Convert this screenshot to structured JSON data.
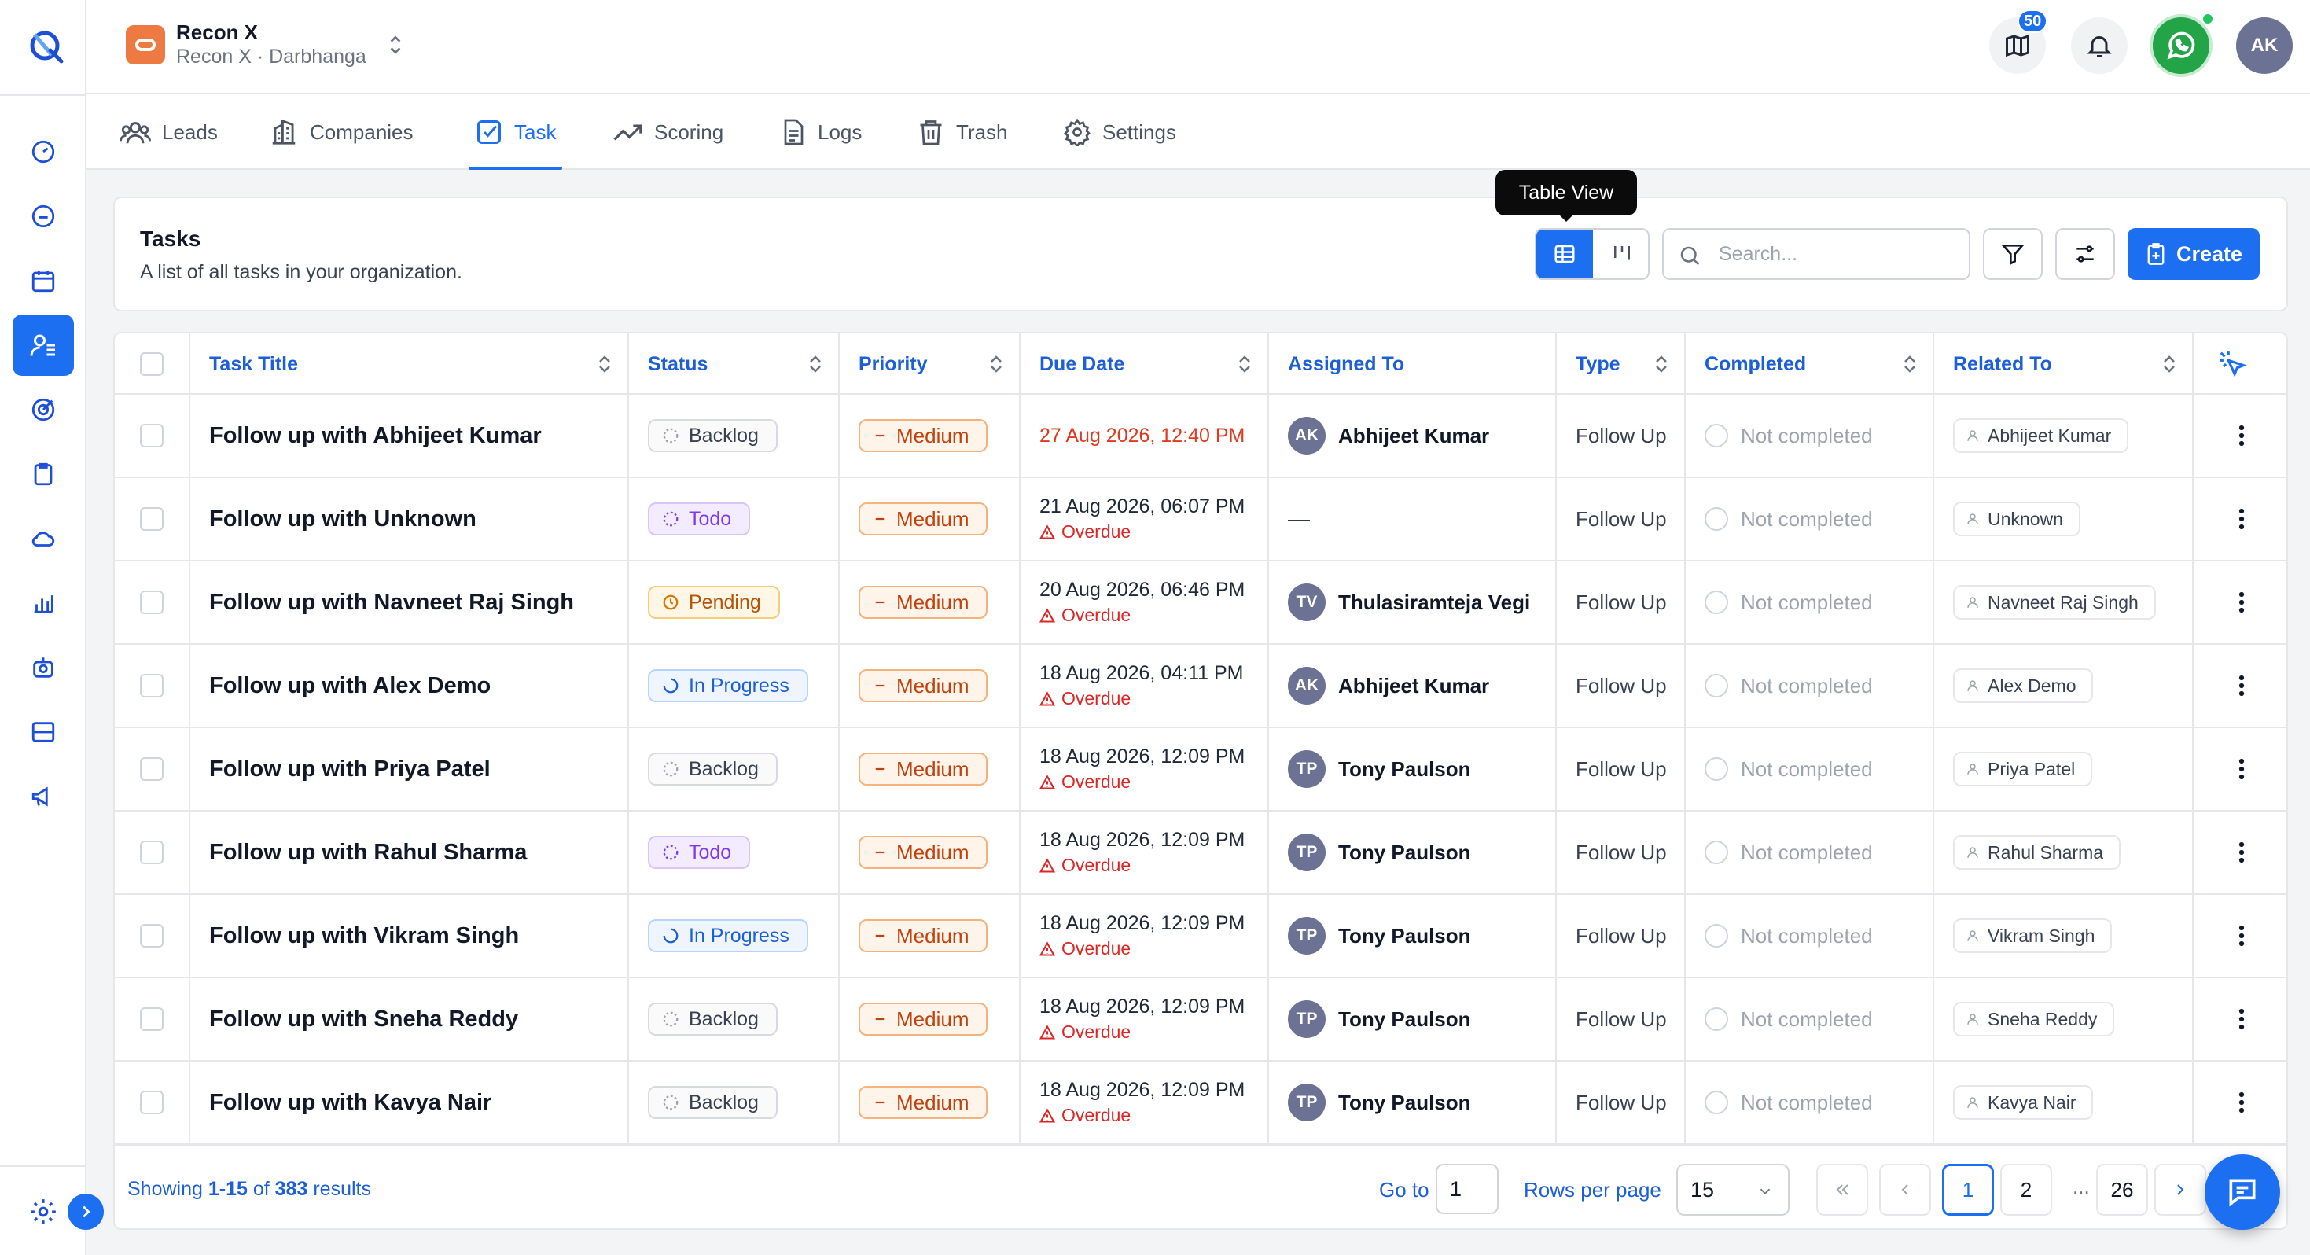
{
  "org": {
    "name": "Recon X",
    "subtitle": "Recon X · Darbhanga"
  },
  "header": {
    "notification_count": "50",
    "user_initials": "AK"
  },
  "tabs": [
    {
      "label": "Leads",
      "icon": "users-icon"
    },
    {
      "label": "Companies",
      "icon": "building-icon"
    },
    {
      "label": "Task",
      "icon": "checkbox-icon",
      "active": true
    },
    {
      "label": "Scoring",
      "icon": "trend-icon"
    },
    {
      "label": "Logs",
      "icon": "file-icon"
    },
    {
      "label": "Trash",
      "icon": "trash-icon"
    },
    {
      "label": "Settings",
      "icon": "gear-icon"
    }
  ],
  "page": {
    "title": "Tasks",
    "subtitle": "A list of all tasks in your organization.",
    "tooltip": "Table View",
    "search_placeholder": "Search...",
    "create_label": "Create"
  },
  "columns": [
    "Task Title",
    "Status",
    "Priority",
    "Due Date",
    "Assigned To",
    "Type",
    "Completed",
    "Related To"
  ],
  "rows": [
    {
      "title": "Follow up with Abhijeet Kumar",
      "status": "Backlog",
      "status_kind": "backlog",
      "priority": "Medium",
      "due": "27 Aug 2026, 12:40 PM",
      "overdue": "",
      "assignee_initials": "AK",
      "assignee": "Abhijeet Kumar",
      "type": "Follow Up",
      "completed": "Not completed",
      "related": "Abhijeet Kumar"
    },
    {
      "title": "Follow up with Unknown",
      "status": "Todo",
      "status_kind": "todo",
      "priority": "Medium",
      "due": "21 Aug 2026, 06:07 PM",
      "overdue": "Overdue",
      "assignee_initials": "",
      "assignee": "—",
      "type": "Follow Up",
      "completed": "Not completed",
      "related": "Unknown"
    },
    {
      "title": "Follow up with Navneet Raj Singh",
      "status": "Pending",
      "status_kind": "pending",
      "priority": "Medium",
      "due": "20 Aug 2026, 06:46 PM",
      "overdue": "Overdue",
      "assignee_initials": "TV",
      "assignee": "Thulasiramteja Vegi",
      "type": "Follow Up",
      "completed": "Not completed",
      "related": "Navneet Raj Singh"
    },
    {
      "title": "Follow up with Alex Demo",
      "status": "In Progress",
      "status_kind": "progress",
      "priority": "Medium",
      "due": "18 Aug 2026, 04:11 PM",
      "overdue": "Overdue",
      "assignee_initials": "AK",
      "assignee": "Abhijeet Kumar",
      "type": "Follow Up",
      "completed": "Not completed",
      "related": "Alex Demo"
    },
    {
      "title": "Follow up with Priya Patel",
      "status": "Backlog",
      "status_kind": "backlog",
      "priority": "Medium",
      "due": "18 Aug 2026, 12:09 PM",
      "overdue": "Overdue",
      "assignee_initials": "TP",
      "assignee": "Tony Paulson",
      "type": "Follow Up",
      "completed": "Not completed",
      "related": "Priya Patel"
    },
    {
      "title": "Follow up with Rahul Sharma",
      "status": "Todo",
      "status_kind": "todo",
      "priority": "Medium",
      "due": "18 Aug 2026, 12:09 PM",
      "overdue": "Overdue",
      "assignee_initials": "TP",
      "assignee": "Tony Paulson",
      "type": "Follow Up",
      "completed": "Not completed",
      "related": "Rahul Sharma"
    },
    {
      "title": "Follow up with Vikram Singh",
      "status": "In Progress",
      "status_kind": "progress",
      "priority": "Medium",
      "due": "18 Aug 2026, 12:09 PM",
      "overdue": "Overdue",
      "assignee_initials": "TP",
      "assignee": "Tony Paulson",
      "type": "Follow Up",
      "completed": "Not completed",
      "related": "Vikram Singh"
    },
    {
      "title": "Follow up with Sneha Reddy",
      "status": "Backlog",
      "status_kind": "backlog",
      "priority": "Medium",
      "due": "18 Aug 2026, 12:09 PM",
      "overdue": "Overdue",
      "assignee_initials": "TP",
      "assignee": "Tony Paulson",
      "type": "Follow Up",
      "completed": "Not completed",
      "related": "Sneha Reddy"
    },
    {
      "title": "Follow up with Kavya Nair",
      "status": "Backlog",
      "status_kind": "backlog",
      "priority": "Medium",
      "due": "18 Aug 2026, 12:09 PM",
      "overdue": "Overdue",
      "assignee_initials": "TP",
      "assignee": "Tony Paulson",
      "type": "Follow Up",
      "completed": "Not completed",
      "related": "Kavya Nair"
    }
  ],
  "footer": {
    "showing_prefix": "Showing",
    "showing_range": "1-15",
    "showing_of": "of",
    "showing_total": "383",
    "showing_suffix": "results",
    "goto_label": "Go to",
    "goto_value": "1",
    "rows_per_page_label": "Rows per page",
    "rows_per_page_value": "15",
    "pages": [
      "1",
      "2",
      "...",
      "26"
    ]
  },
  "colors": {
    "primary": "#1d6ff2",
    "whatsapp": "#22a447",
    "org_logo": "#ee7a43",
    "overdue": "#dc2626"
  }
}
